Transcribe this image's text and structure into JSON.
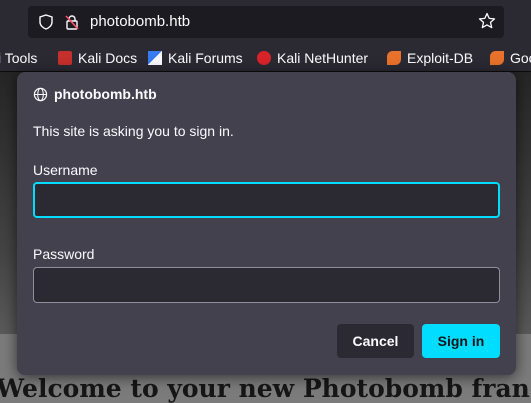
{
  "browser": {
    "url": "photobomb.htb",
    "bookmarks": [
      {
        "label": "i Tools",
        "icon": "kali-tools-icon"
      },
      {
        "label": "Kali Docs",
        "icon": "kali-docs-icon"
      },
      {
        "label": "Kali Forums",
        "icon": "kali-forums-icon"
      },
      {
        "label": "Kali NetHunter",
        "icon": "kali-nethunter-icon"
      },
      {
        "label": "Exploit-DB",
        "icon": "exploit-db-icon"
      },
      {
        "label": "Goo",
        "icon": "google-icon"
      }
    ]
  },
  "page": {
    "welcome_heading": "Welcome to your new Photobomb franchise!"
  },
  "auth_dialog": {
    "site": "photobomb.htb",
    "message": "This site is asking you to sign in.",
    "username_label": "Username",
    "username_value": "",
    "password_label": "Password",
    "password_value": "",
    "cancel_label": "Cancel",
    "signin_label": "Sign in"
  },
  "colors": {
    "accent": "#00ddff",
    "dialog_bg": "#42414d",
    "toolbar_bg": "#2b2a33"
  }
}
